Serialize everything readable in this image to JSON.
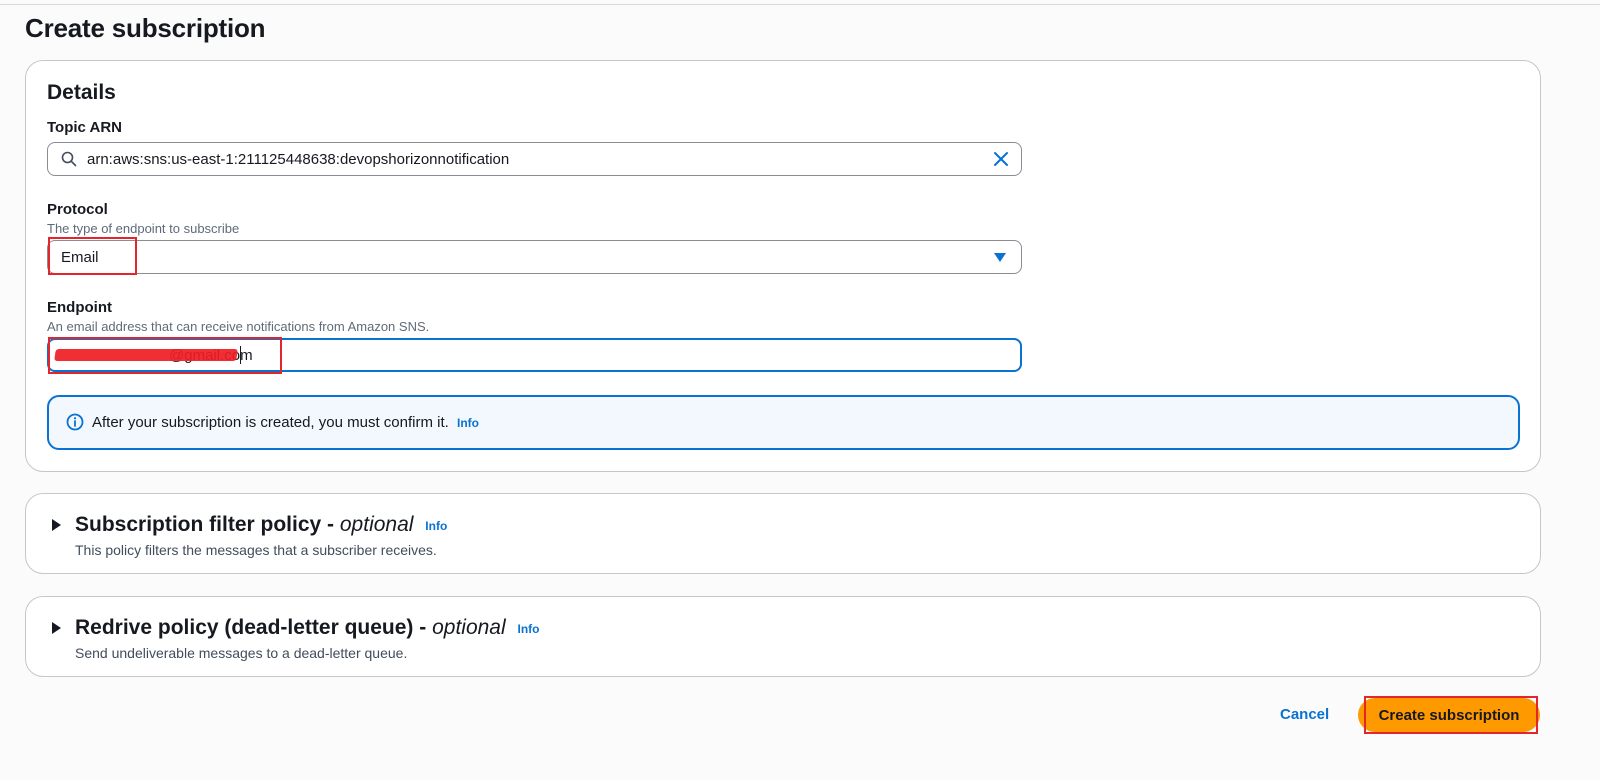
{
  "page": {
    "title": "Create subscription"
  },
  "details": {
    "heading": "Details",
    "topic_arn": {
      "label": "Topic ARN",
      "value": "arn:aws:sns:us-east-1:211125448638:devopshorizonnotification"
    },
    "protocol": {
      "label": "Protocol",
      "description": "The type of endpoint to subscribe",
      "selected": "Email"
    },
    "endpoint": {
      "label": "Endpoint",
      "description": "An email address that can receive notifications from Amazon SNS.",
      "value_visible": "@gmail.com"
    },
    "alert": {
      "text": "After your subscription is created, you must confirm it.",
      "info_label": "Info"
    }
  },
  "filter_policy": {
    "title": "Subscription filter policy -",
    "optional": "optional",
    "info_label": "Info",
    "description": "This policy filters the messages that a subscriber receives."
  },
  "redrive_policy": {
    "title": "Redrive policy (dead-letter queue) -",
    "optional": "optional",
    "info_label": "Info",
    "description": "Send undeliverable messages to a dead-letter queue."
  },
  "actions": {
    "cancel_label": "Cancel",
    "create_label": "Create subscription"
  },
  "colors": {
    "accent": "#0972d3",
    "primary_button": "#ff9900",
    "highlight": "#e3262b"
  }
}
